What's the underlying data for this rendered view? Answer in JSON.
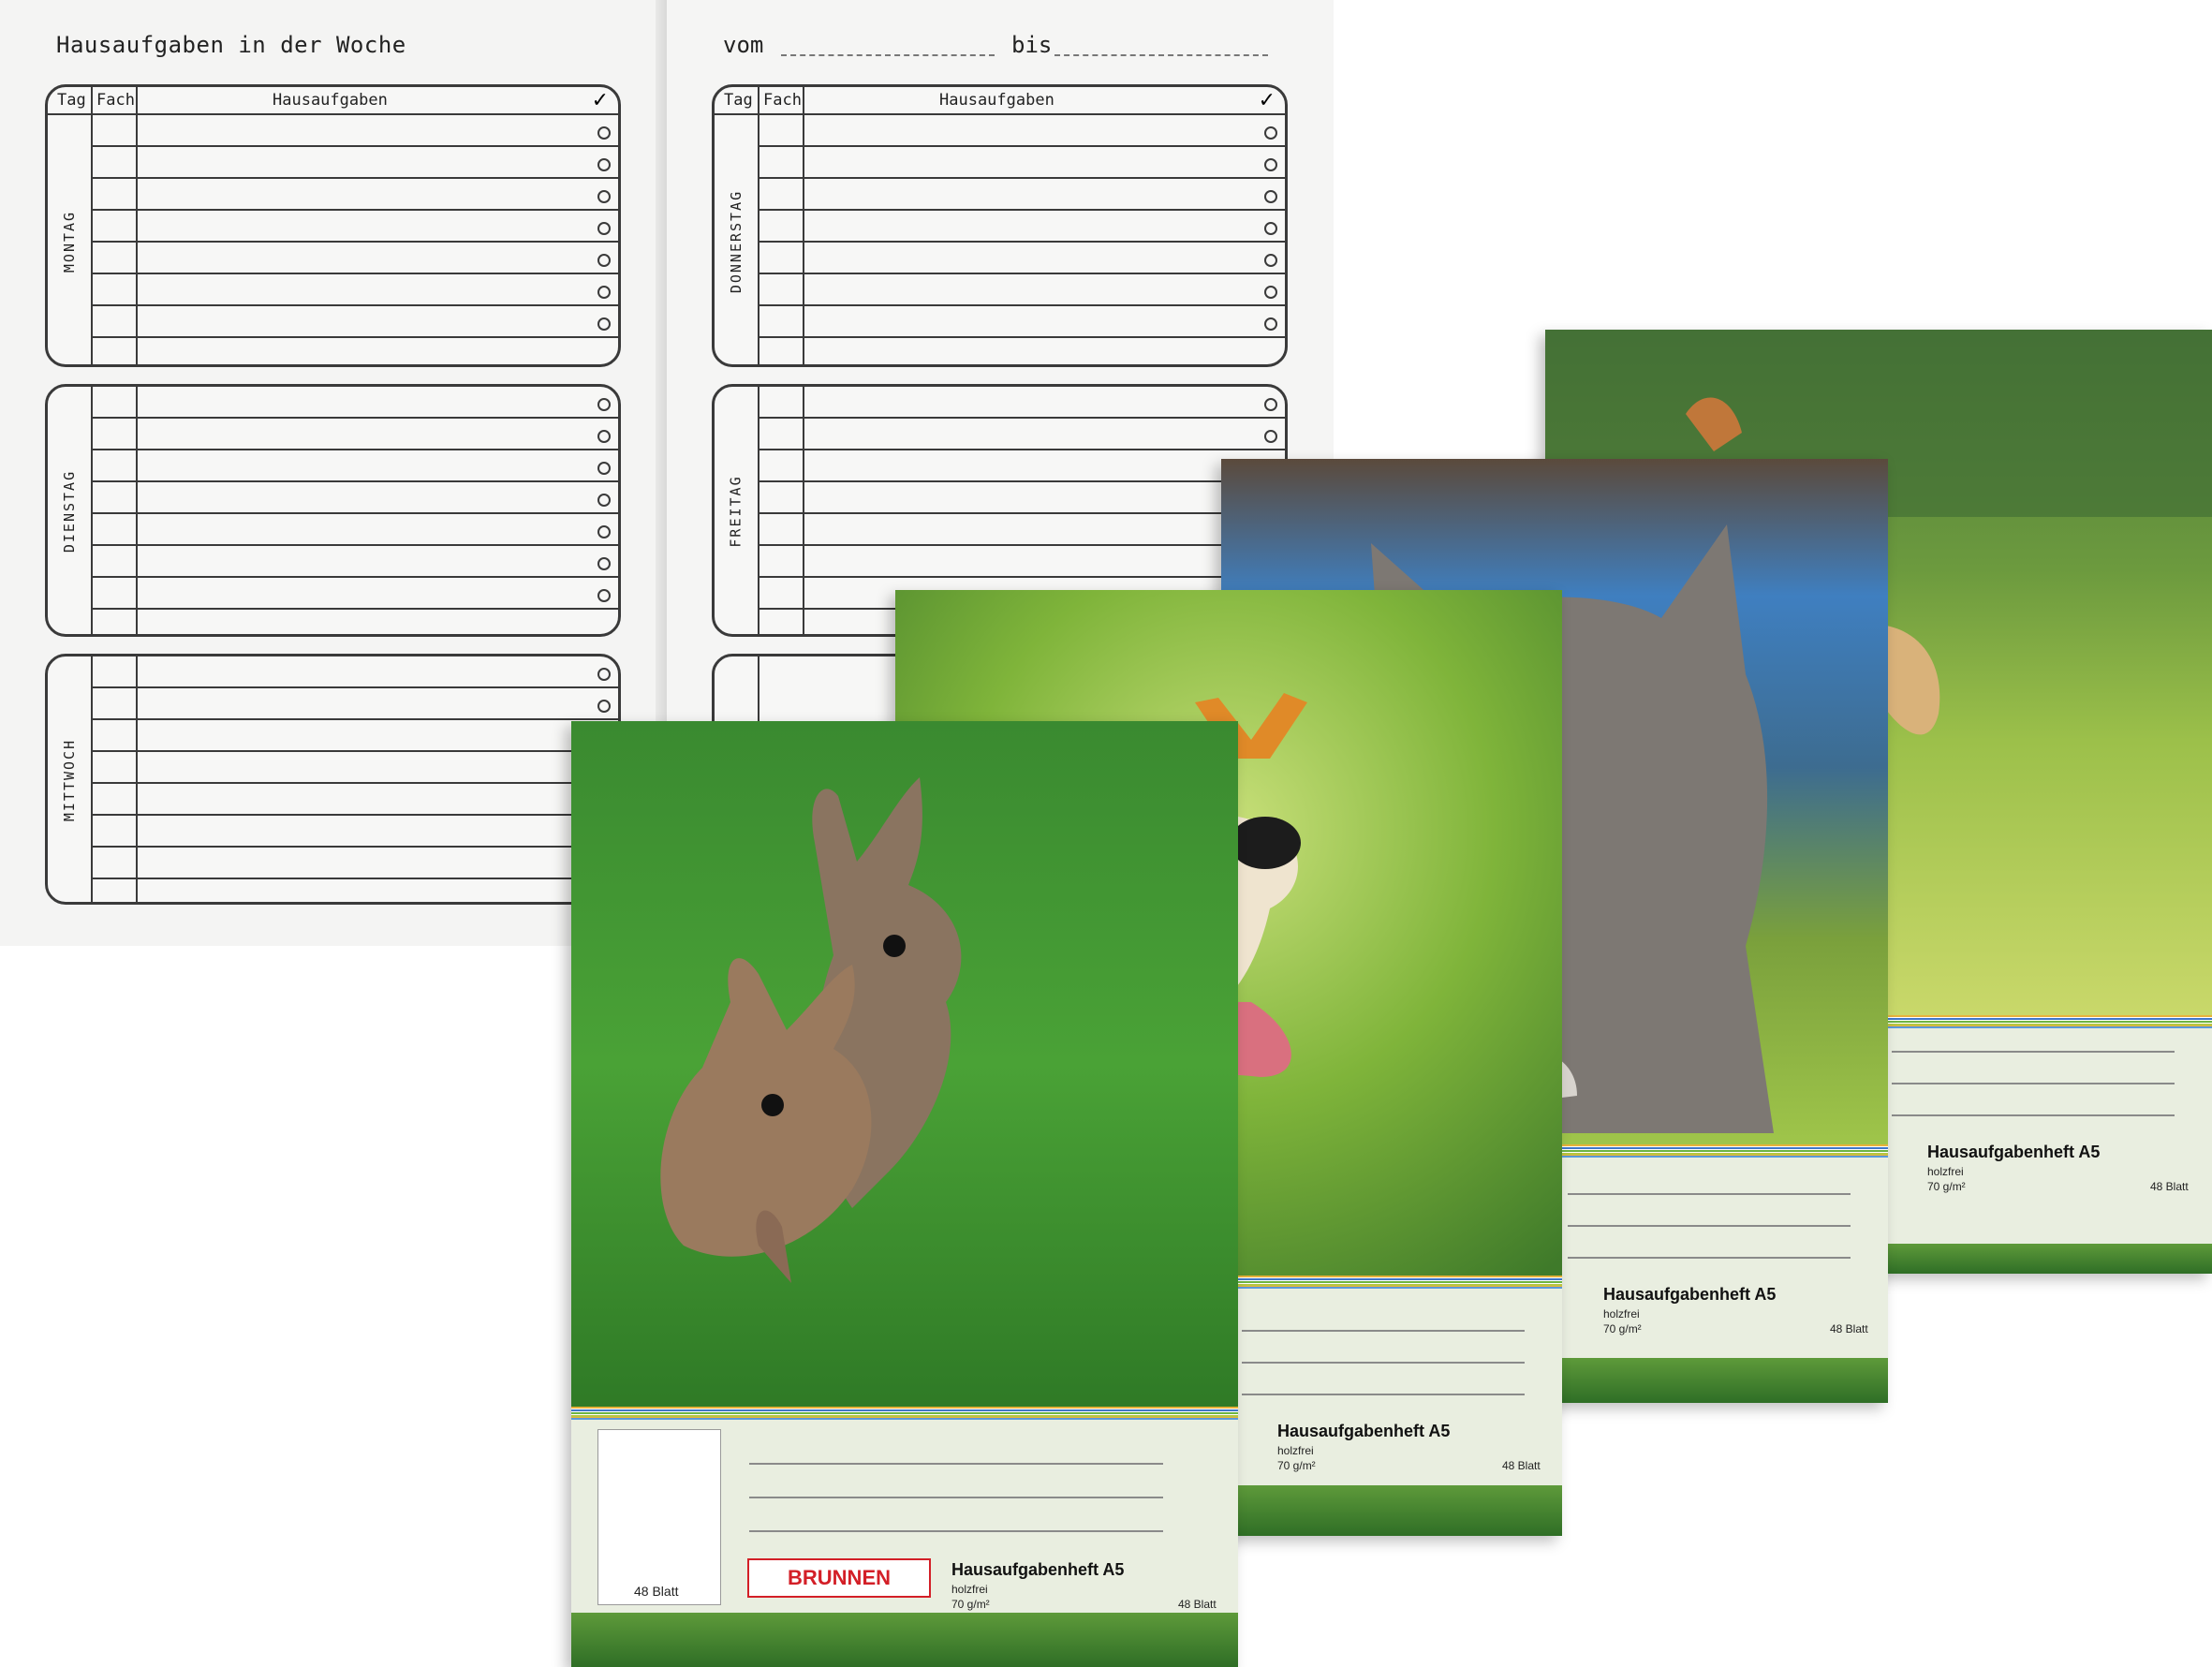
{
  "planner": {
    "title": "Hausaufgaben in der Woche",
    "from_label": "vom",
    "to_label": "bis",
    "col_day": "Tag",
    "col_subject": "Fach",
    "col_homework": "Hausaufgaben",
    "check_glyph": "✓",
    "days_left": [
      "MONTAG",
      "DIENSTAG",
      "MITTWOCH"
    ],
    "days_right": [
      "DONNERSTAG",
      "FREITAG"
    ]
  },
  "covers": {
    "rabbits": {
      "title": "Hausaufgabenheft A5",
      "paper": "holzfrei",
      "weight": "70 g/m²",
      "sheets": "48 Blatt",
      "mini_sheets": "48 Blatt",
      "brand": "BRUNNEN"
    },
    "dog": {
      "title": "Hausaufgabenheft A5",
      "paper": "holzfrei",
      "weight": "70 g/m²",
      "sheets": "48 Blatt"
    },
    "cat": {
      "title": "Hausaufgabenheft A5",
      "paper": "holzfrei",
      "weight": "70 g/m²",
      "sheets": "48 Blatt"
    },
    "horse": {
      "title": "Hausaufgabenheft A5",
      "paper": "holzfrei",
      "weight": "70 g/m²",
      "sheets": "48 Blatt"
    }
  },
  "colors": {
    "brand_red": "#d31f27",
    "grass_green": "#3f8f2c",
    "label_bg": "#e9eee0"
  },
  "icons": [
    "checkmark-icon",
    "brunnen-logo-icon"
  ]
}
